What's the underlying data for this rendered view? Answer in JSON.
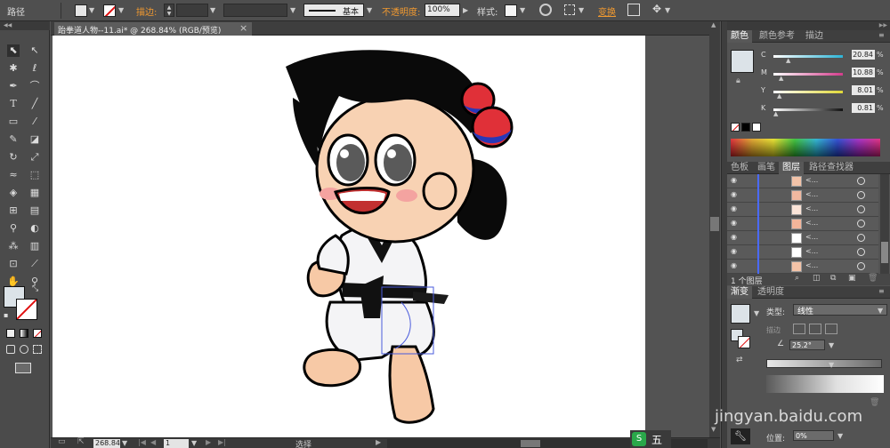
{
  "control_bar": {
    "selection_label": "路径",
    "stroke_label": "描边",
    "brush_label": "基本",
    "opacity_label": "不透明度",
    "opacity_value": "100%",
    "style_label": "样式",
    "transform_label": "变换"
  },
  "document": {
    "tab_title": "跆拳道人物--11.ai* @ 268.84% (RGB/预览)",
    "close_icon": "×"
  },
  "color_panel": {
    "tabs": [
      "颜色",
      "颜色参考",
      "描边"
    ],
    "channels": [
      {
        "name": "C",
        "value": "20.84",
        "unit": "%"
      },
      {
        "name": "M",
        "value": "10.88",
        "unit": "%"
      },
      {
        "name": "Y",
        "value": "8.01",
        "unit": "%"
      },
      {
        "name": "K",
        "value": "0.81",
        "unit": "%"
      }
    ],
    "colors": {
      "c": "#2db4d6",
      "m": "#d43c8c",
      "y": "#e0d838",
      "k": "#111111"
    }
  },
  "layers_panel": {
    "tabs": [
      "色板",
      "画笔",
      "图层",
      "路径查找器"
    ],
    "rows": [
      "<...",
      "<...",
      "<...",
      "<...",
      "<...",
      "<...",
      "<..."
    ],
    "count_label": "1 个图层"
  },
  "gradient_panel": {
    "tabs": [
      "渐变",
      "透明度"
    ],
    "type_label": "类型:",
    "type_value": "线性",
    "stroke_label": "描边",
    "angle_value": "25.2°",
    "position_label": "位置:",
    "position_value": "0%"
  },
  "status_bar": {
    "zoom_value": "268.84",
    "page_value": "1",
    "tool_label": "选择"
  },
  "watermark": {
    "text": "jingyan.baidu.com",
    "taskbar_label": "五"
  }
}
